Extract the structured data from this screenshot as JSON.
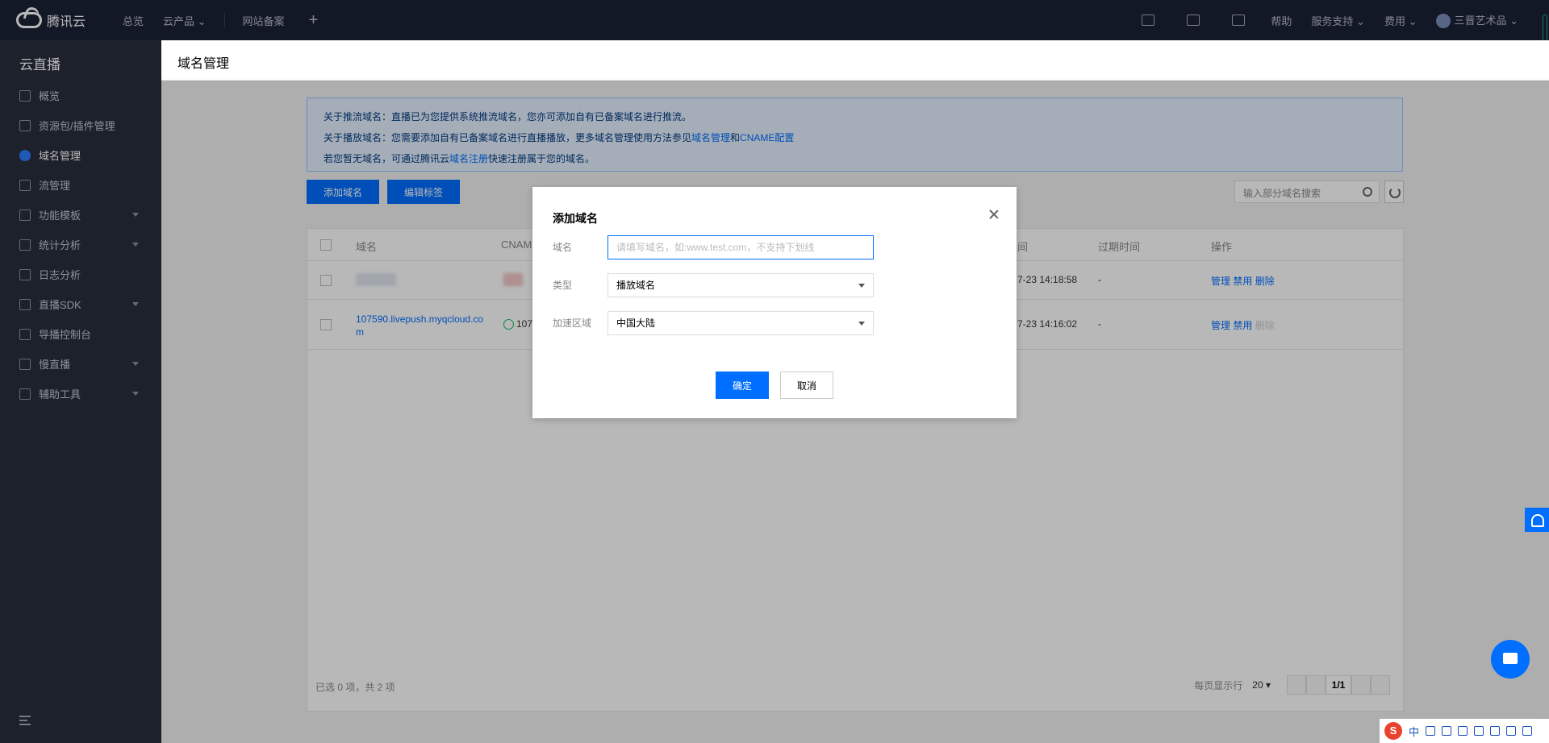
{
  "topbar": {
    "brand": "腾讯云",
    "nav": [
      "总览",
      "云产品",
      "网站备案"
    ],
    "plus": "+",
    "right": [
      "帮助",
      "服务支持",
      "费用"
    ],
    "user": "三晋艺术品"
  },
  "sidebar": {
    "title": "云直播",
    "items": [
      {
        "label": "概览",
        "icon": "grid-icon"
      },
      {
        "label": "资源包/插件管理",
        "icon": "package-icon"
      },
      {
        "label": "域名管理",
        "icon": "globe-icon",
        "active": true
      },
      {
        "label": "流管理",
        "icon": "stream-icon"
      },
      {
        "label": "功能模板",
        "icon": "template-icon",
        "expandable": true
      },
      {
        "label": "统计分析",
        "icon": "chart-icon",
        "expandable": true
      },
      {
        "label": "日志分析",
        "icon": "calendar-icon"
      },
      {
        "label": "直播SDK",
        "icon": "play-icon",
        "expandable": true
      },
      {
        "label": "导播控制台",
        "icon": "monitor-icon"
      },
      {
        "label": "慢直播",
        "icon": "video-icon",
        "expandable": true
      },
      {
        "label": "辅助工具",
        "icon": "tool-icon",
        "expandable": true
      }
    ]
  },
  "page": {
    "title": "域名管理"
  },
  "notice": {
    "line1": "关于推流域名：直播已为您提供系统推流域名，您亦可添加自有已备案域名进行推流。",
    "line2_prefix": "关于播放域名：您需要添加自有已备案域名进行直播播放，更多域名管理使用方法参见",
    "line2_link1": "域名管理",
    "line2_and": "和",
    "line2_link2": "CNAME配置",
    "line3_prefix": "若您暂无域名，可通过腾讯云",
    "line3_link": "域名注册",
    "line3_suffix": "快速注册属于您的域名。"
  },
  "toolbar": {
    "add_label": "添加域名",
    "edit_tags_label": "编辑标签",
    "search_placeholder": "输入部分域名搜索"
  },
  "table": {
    "columns": [
      "域名",
      "CNAME",
      "间",
      "过期时间",
      "操作"
    ],
    "rows": [
      {
        "domain": "",
        "cname": "",
        "time": "7-23 14:18:58",
        "expire": "-",
        "actions": [
          "管理",
          "禁用",
          "删除"
        ]
      },
      {
        "domain": "107590.livepush.myqcloud.com",
        "cname": "107",
        "time": "7-23 14:16:02",
        "expire": "-",
        "actions": [
          "管理",
          "禁用",
          "删除"
        ]
      }
    ],
    "footer_selected": "已选 0 项，共 2 项",
    "page_size_label": "每页显示行",
    "page_size": "20",
    "page_indicator": "1/1"
  },
  "dialog": {
    "title": "添加域名",
    "domain_label": "域名",
    "domain_placeholder": "请填写域名，如:www.test.com，不支持下划线",
    "type_label": "类型",
    "type_value": "播放域名",
    "region_label": "加速区域",
    "region_value": "中国大陆",
    "ok_label": "确定",
    "cancel_label": "取消"
  },
  "ime": {
    "logo": "S",
    "lang": "中"
  }
}
